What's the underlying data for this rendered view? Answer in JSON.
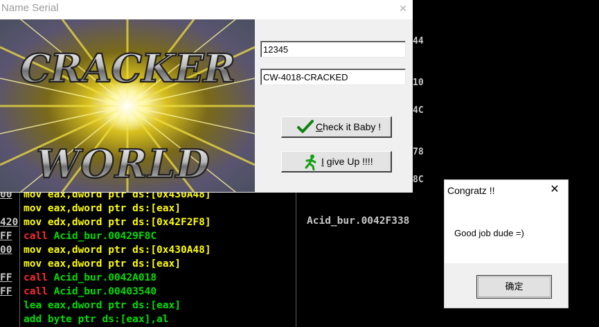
{
  "debugger": {
    "hex_suffixes": [
      "44",
      "10",
      "4C",
      "78",
      "8C"
    ],
    "lines": [
      {
        "addr": "00",
        "code": "mov eax,dword ptr ds:[0x430A48]",
        "color": "yellow"
      },
      {
        "addr": "",
        "code": "mov eax,dword ptr ds:[eax]",
        "color": "yellow"
      },
      {
        "addr": "420",
        "code": "mov edx,dword ptr ds:[0x42F2F8]",
        "color": "yellow"
      },
      {
        "addr": "FF",
        "code": "call Acid_bur.00429F8C",
        "color": "call"
      },
      {
        "addr": "00",
        "code": "mov eax,dword ptr ds:[0x430A48]",
        "color": "yellow"
      },
      {
        "addr": "",
        "code": "mov eax,dword ptr ds:[eax]",
        "color": "yellow"
      },
      {
        "addr": "FF",
        "code": "call Acid_bur.0042A018",
        "color": "call"
      },
      {
        "addr": "FF",
        "code": "call Acid_bur.00403540",
        "color": "call"
      },
      {
        "addr": "",
        "code": "lea eax,dword ptr ds:[eax]",
        "color": "green"
      },
      {
        "addr": "",
        "code": "add byte ptr ds:[eax],al",
        "color": "green"
      }
    ],
    "comment": "Acid_bur.0042F338"
  },
  "crackme": {
    "title": "Name Serial",
    "close_glyph": "✕",
    "banner": {
      "line1": "CRACKER",
      "line2": "WORLD"
    },
    "name_value": "12345",
    "serial_value": "CW-4018-CRACKED",
    "check_button": {
      "underline": "C",
      "rest": "heck it Baby !"
    },
    "giveup_button": {
      "underline": "I",
      "rest": " give Up !!!!"
    }
  },
  "dialog": {
    "title": "Congratz !!",
    "close_glyph": "✕",
    "message": "Good job dude =)",
    "ok_label": "确定"
  },
  "colors": {
    "mov": "#ffff00",
    "call_keyword": "#ff2a2a",
    "call_target": "#00e000",
    "lea_add": "#00e000"
  }
}
